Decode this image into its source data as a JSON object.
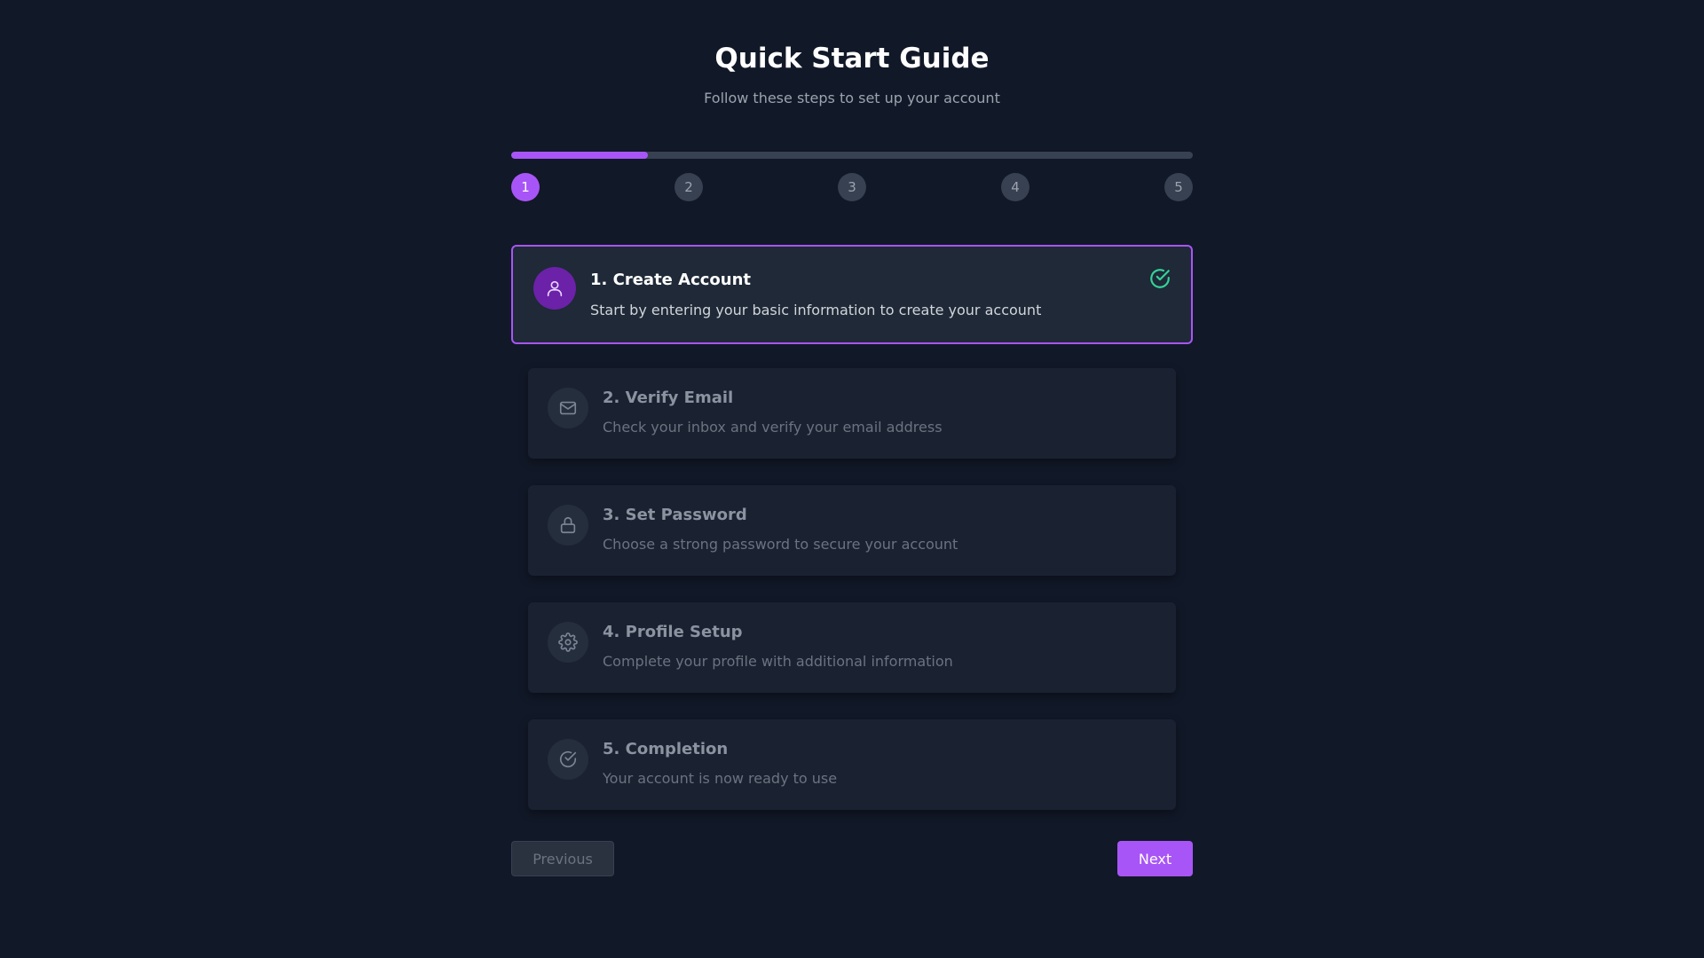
{
  "header": {
    "title": "Quick Start Guide",
    "subtitle": "Follow these steps to set up your account"
  },
  "progress": {
    "current_step": 1,
    "total_steps": 5,
    "fraction": 0.2,
    "dots": [
      "1",
      "2",
      "3",
      "4",
      "5"
    ]
  },
  "steps": [
    {
      "title": "1. Create Account",
      "description": "Start by entering your basic information to create your account",
      "icon": "user-icon",
      "state": "active",
      "completed": true
    },
    {
      "title": "2. Verify Email",
      "description": "Check your inbox and verify your email address",
      "icon": "mail-icon",
      "state": "inactive"
    },
    {
      "title": "3. Set Password",
      "description": "Choose a strong password to secure your account",
      "icon": "lock-icon",
      "state": "inactive"
    },
    {
      "title": "4. Profile Setup",
      "description": "Complete your profile with additional information",
      "icon": "gear-icon",
      "state": "inactive"
    },
    {
      "title": "5. Completion",
      "description": "Your account is now ready to use",
      "icon": "check-circle-icon",
      "state": "inactive"
    }
  ],
  "nav": {
    "previous_label": "Previous",
    "next_label": "Next"
  },
  "colors": {
    "background": "#111827",
    "accent": "#a855f7",
    "success": "#34d399"
  }
}
